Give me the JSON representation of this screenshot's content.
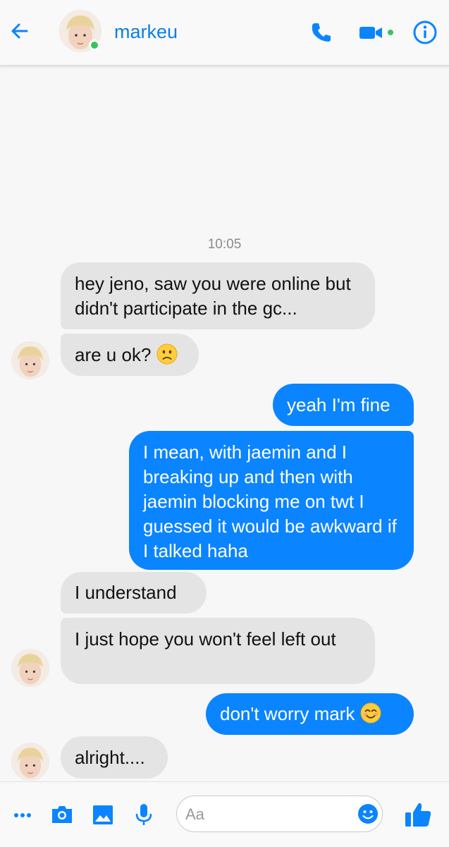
{
  "header": {
    "contact_name": "markeu",
    "online": true,
    "accent_color": "#0b84ff",
    "icons": [
      "back-arrow-icon",
      "phone-icon",
      "video-camera-icon",
      "info-icon"
    ]
  },
  "conversation": {
    "timestamp": "10:05",
    "messages": [
      {
        "from": "markeu",
        "text": "hey jeno, saw you were online but didn't participate in the gc..."
      },
      {
        "from": "markeu",
        "text": "are u ok?",
        "emoji": "slightly-frowning-face"
      },
      {
        "from": "me",
        "text": "yeah I'm fine"
      },
      {
        "from": "me",
        "text": "I mean, with jaemin and I breaking up and then with jaemin blocking me on twt I guessed it would be awkward if I talked haha"
      },
      {
        "from": "markeu",
        "text": "I understand"
      },
      {
        "from": "markeu",
        "text": "I just hope you won't feel left out"
      },
      {
        "from": "me",
        "text": "don't worry mark",
        "emoji": "smiling-face-with-smiling-eyes"
      },
      {
        "from": "markeu",
        "text": "alright...."
      }
    ]
  },
  "composer": {
    "placeholder": "Aa",
    "icons": [
      "more-icon",
      "camera-icon",
      "gallery-icon",
      "microphone-icon",
      "emoji-icon",
      "thumbs-up-icon"
    ]
  }
}
